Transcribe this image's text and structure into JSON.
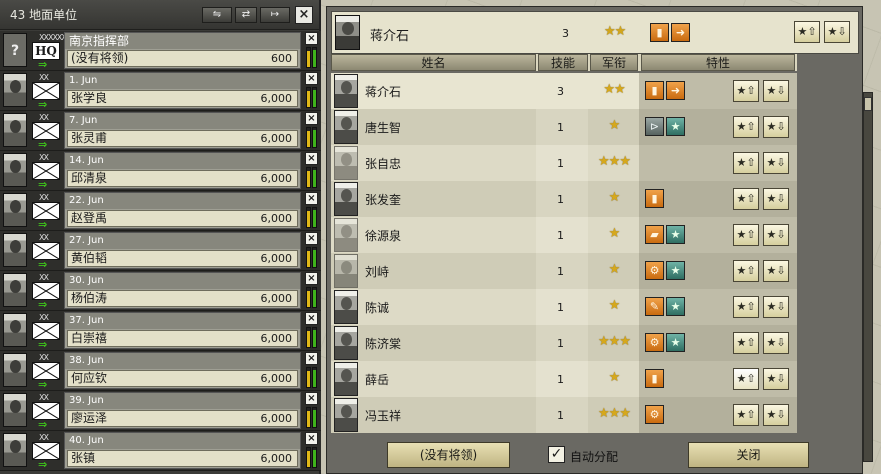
{
  "left_panel": {
    "title": "43 地面单位",
    "header_buttons": [
      "⇋",
      "⇄",
      "↦"
    ],
    "close": "×",
    "hq": {
      "xx": "XXXXXX",
      "symbol": "HQ",
      "title": "南京指挥部",
      "leader": "(没有将领)",
      "strength": "600"
    },
    "units": [
      {
        "date": "1. Jun",
        "name": "张学良",
        "strength": "6,000",
        "org": 0.85,
        "str": 0.9
      },
      {
        "date": "7. Jun",
        "name": "张灵甫",
        "strength": "6,000",
        "org": 0.85,
        "str": 0.9
      },
      {
        "date": "14. Jun",
        "name": "邱清泉",
        "strength": "6,000",
        "org": 0.85,
        "str": 0.9
      },
      {
        "date": "22. Jun",
        "name": "赵登禹",
        "strength": "6,000",
        "org": 0.85,
        "str": 0.9
      },
      {
        "date": "27. Jun",
        "name": "黄伯韬",
        "strength": "6,000",
        "org": 0.85,
        "str": 0.9
      },
      {
        "date": "30. Jun",
        "name": "杨伯涛",
        "strength": "6,000",
        "org": 0.85,
        "str": 0.9
      },
      {
        "date": "37. Jun",
        "name": "白崇禧",
        "strength": "6,000",
        "org": 0.85,
        "str": 0.9
      },
      {
        "date": "38. Jun",
        "name": "何应钦",
        "strength": "6,000",
        "org": 0.85,
        "str": 0.9
      },
      {
        "date": "39. Jun",
        "name": "廖运泽",
        "strength": "6,000",
        "org": 0.85,
        "str": 0.9
      },
      {
        "date": "40. Jun",
        "name": "张镇",
        "strength": "6,000",
        "org": 0.85,
        "str": 0.9
      }
    ],
    "xx": "XX",
    "arrow": "⇒",
    "remove": "×"
  },
  "selected_leader": {
    "name": "蒋介石",
    "skill": "3",
    "rank": "★★",
    "traits": [
      "▮",
      "➜"
    ]
  },
  "columns": {
    "name": "姓名",
    "skill": "技能",
    "rank": "军衔",
    "traits": "特性"
  },
  "leaders": [
    {
      "name": "蒋介石",
      "skill": "3",
      "rank": "★★",
      "traits": [
        {
          "g": "▮",
          "c": "orange"
        },
        {
          "g": "➜",
          "c": "orange"
        }
      ]
    },
    {
      "name": "唐生智",
      "skill": "1",
      "rank": "★",
      "traits": [
        {
          "g": "⊳",
          "c": "gray"
        },
        {
          "g": "★",
          "c": "teal"
        }
      ]
    },
    {
      "name": "张自忠",
      "skill": "1",
      "rank": "★★★",
      "traits": []
    },
    {
      "name": "张发奎",
      "skill": "1",
      "rank": "★",
      "traits": [
        {
          "g": "▮",
          "c": "orange"
        }
      ]
    },
    {
      "name": "徐源泉",
      "skill": "1",
      "rank": "★",
      "traits": [
        {
          "g": "▰",
          "c": "orange"
        },
        {
          "g": "★",
          "c": "teal"
        }
      ]
    },
    {
      "name": "刘峙",
      "skill": "1",
      "rank": "★",
      "traits": [
        {
          "g": "⚙",
          "c": "orange"
        },
        {
          "g": "★",
          "c": "teal"
        }
      ]
    },
    {
      "name": "陈诚",
      "skill": "1",
      "rank": "★",
      "traits": [
        {
          "g": "✎",
          "c": "orange"
        },
        {
          "g": "★",
          "c": "teal"
        }
      ]
    },
    {
      "name": "陈济棠",
      "skill": "1",
      "rank": "★★★",
      "traits": [
        {
          "g": "⚙",
          "c": "orange"
        },
        {
          "g": "★",
          "c": "teal"
        }
      ]
    },
    {
      "name": "薛岳",
      "skill": "1",
      "rank": "★",
      "traits": [
        {
          "g": "▮",
          "c": "orange"
        }
      ]
    },
    {
      "name": "冯玉祥",
      "skill": "1",
      "rank": "★★★",
      "traits": [
        {
          "g": "⚙",
          "c": "orange"
        }
      ]
    }
  ],
  "move_buttons": {
    "promote": "★⇧",
    "demote": "★⇩"
  },
  "footer": {
    "no_leader_button": "(没有将领)",
    "auto_assign_label": "自动分配",
    "auto_assign_checked": "✓",
    "close_button": "关闭"
  },
  "colors": {
    "panel_dark": "#3b3b38",
    "rank_star": "#d6a81c",
    "trait_orange": "#e08a2a",
    "trait_teal": "#4f9486",
    "strength_green": "#3fb41b",
    "org_yellow": "#e0b818"
  }
}
